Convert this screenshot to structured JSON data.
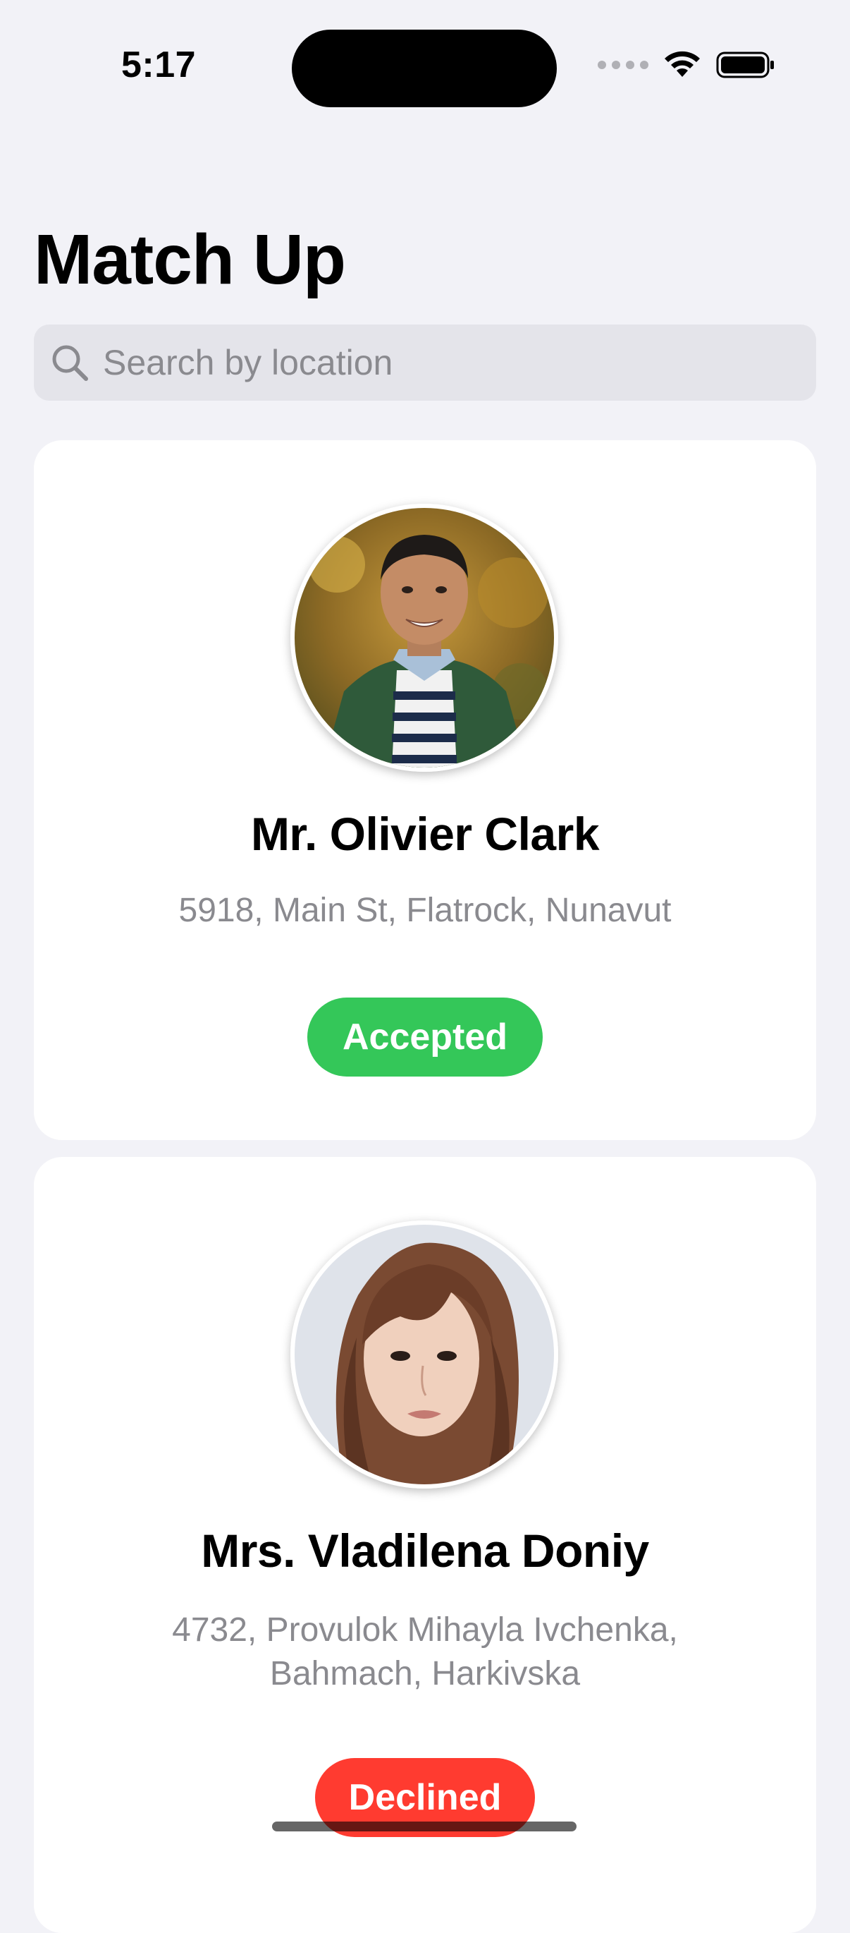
{
  "status_bar": {
    "time": "5:17",
    "icons": [
      "cellular-icon",
      "wifi-icon",
      "battery-icon"
    ]
  },
  "header": {
    "title": "Match Up"
  },
  "search": {
    "placeholder": "Search by location",
    "value": "",
    "icon": "search-icon"
  },
  "matches": [
    {
      "name": "Mr. Olivier Clark",
      "address": "5918, Main St, Flatrock, Nunavut",
      "status": "Accepted",
      "status_color": "#34C759",
      "avatar": "man-portrait-avatar"
    },
    {
      "name": "Mrs. Vladilena Doniy",
      "address": "4732, Provulok Mihayla Ivchenka, Bahmach, Harkivska",
      "status": "Declined",
      "status_color": "#FF3B30",
      "avatar": "woman-portrait-avatar"
    }
  ],
  "colors": {
    "background": "#F2F2F7",
    "card": "#FFFFFF",
    "accepted": "#34C759",
    "declined": "#FF3B30",
    "secondary_text": "#8A8A8F"
  }
}
